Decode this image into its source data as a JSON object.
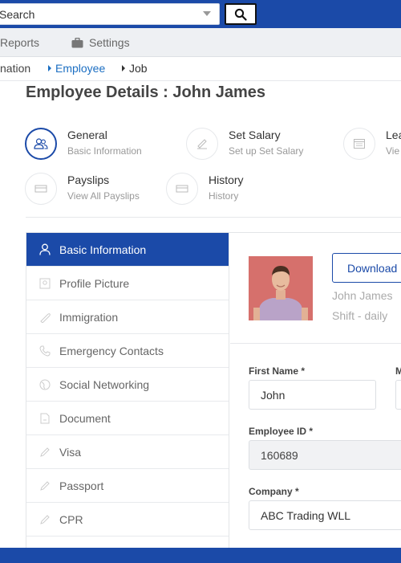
{
  "search": {
    "placeholder": "Search"
  },
  "menu": {
    "reports": "Reports",
    "settings": "Settings"
  },
  "breadcrumb": [
    "nation",
    "Employee",
    "Job"
  ],
  "page_title": "Employee Details : John James",
  "tiles": [
    {
      "title": "General",
      "sub": "Basic Information",
      "icon": "users-icon",
      "active": true
    },
    {
      "title": "Set Salary",
      "sub": "Set up Set Salary",
      "icon": "salary-icon"
    },
    {
      "title": "Lea",
      "sub": "Vie",
      "icon": "calendar-icon"
    },
    {
      "title": "Payslips",
      "sub": "View All Payslips",
      "icon": "payslip-icon"
    },
    {
      "title": "History",
      "sub": "History",
      "icon": "history-icon"
    }
  ],
  "nav": [
    {
      "label": "Basic Information",
      "icon": "user-icon",
      "active": true
    },
    {
      "label": "Profile Picture",
      "icon": "image-icon"
    },
    {
      "label": "Immigration",
      "icon": "passport-icon"
    },
    {
      "label": "Emergency Contacts",
      "icon": "phone-icon"
    },
    {
      "label": "Social Networking",
      "icon": "globe-icon"
    },
    {
      "label": "Document",
      "icon": "document-icon"
    },
    {
      "label": "Visa",
      "icon": "pencil-icon"
    },
    {
      "label": "Passport",
      "icon": "pencil-icon"
    },
    {
      "label": "CPR",
      "icon": "pencil-icon"
    }
  ],
  "profile": {
    "download_label": "Download",
    "name": "John James",
    "shift": "Shift - daily"
  },
  "form": {
    "first_name_label": "First Name *",
    "first_name_value": "John",
    "middle_label": "M",
    "employee_id_label": "Employee ID *",
    "employee_id_value": "160689",
    "company_label": "Company *",
    "company_value": "ABC Trading WLL"
  },
  "colors": {
    "primary": "#1b4aa8",
    "link": "#1b6ec2"
  }
}
